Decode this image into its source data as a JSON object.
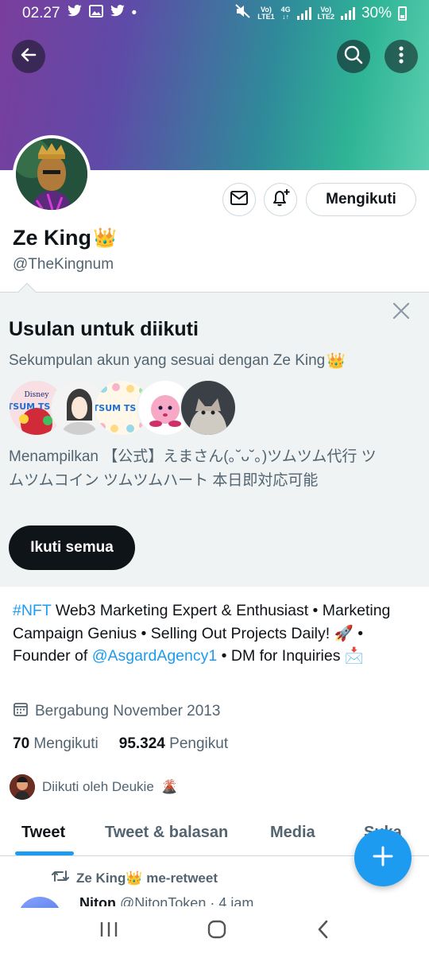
{
  "status_bar": {
    "time": "02.27",
    "dot": "•",
    "sim1_top": "Vo)",
    "sim1_bottom": "LTE1",
    "net_top": "4G",
    "net_bottom": "↓↑",
    "sim2_top": "Vo)",
    "sim2_bottom": "LTE2",
    "battery": "30%"
  },
  "header": {
    "back_icon": "arrow-left-icon",
    "search_icon": "search-icon",
    "more_icon": "more-vertical-icon"
  },
  "profile": {
    "name": "Ze King",
    "name_emoji": "👑",
    "handle": "@TheKingnum",
    "follow_label": "Mengikuti"
  },
  "suggestions": {
    "title": "Usulan untuk diikuti",
    "subtitle": "Sekumpulan akun yang sesuai dengan Ze King",
    "subtitle_emoji": "👑",
    "description": "Menampilkan 【公式】えまさん(｡˘ᴗ˘｡)ツムツム代行 ツムツムコイン ツムツムハート 本日即対応可能",
    "follow_all_label": "Ikuti semua",
    "avatar_labels": [
      "Disney",
      "TSUM TSUM",
      "TSUM TSUM"
    ]
  },
  "bio": {
    "hashtag": "#NFT",
    "text1": " Web3 Marketing Expert & Enthusiast • Marketing Campaign Genius • Selling Out Projects Daily! ",
    "rocket": "🚀",
    "text2": " • Founder of ",
    "mention": "@AsgardAgency1",
    "text3": " • DM for Inquiries ",
    "mail": "📩"
  },
  "joined": "Bergabung November 2013",
  "stats": {
    "following_count": "70",
    "following_label": "Mengikuti",
    "followers_count": "95.324",
    "followers_label": "Pengikut"
  },
  "followed_by": {
    "text": "Diikuti oleh Deukie",
    "emoji": "🌋"
  },
  "tabs": [
    "Tweet",
    "Tweet & balasan",
    "Media",
    "Suka"
  ],
  "retweet_label": "Ze King",
  "retweet_emoji": "👑",
  "retweet_suffix": " me-retweet",
  "tweet_preview": {
    "author": "Niton",
    "handle": "@NitonToken",
    "time": "· 4 jam"
  },
  "colors": {
    "accent": "#1d9bf0",
    "text": "#0f1419",
    "secondary": "#536471"
  }
}
